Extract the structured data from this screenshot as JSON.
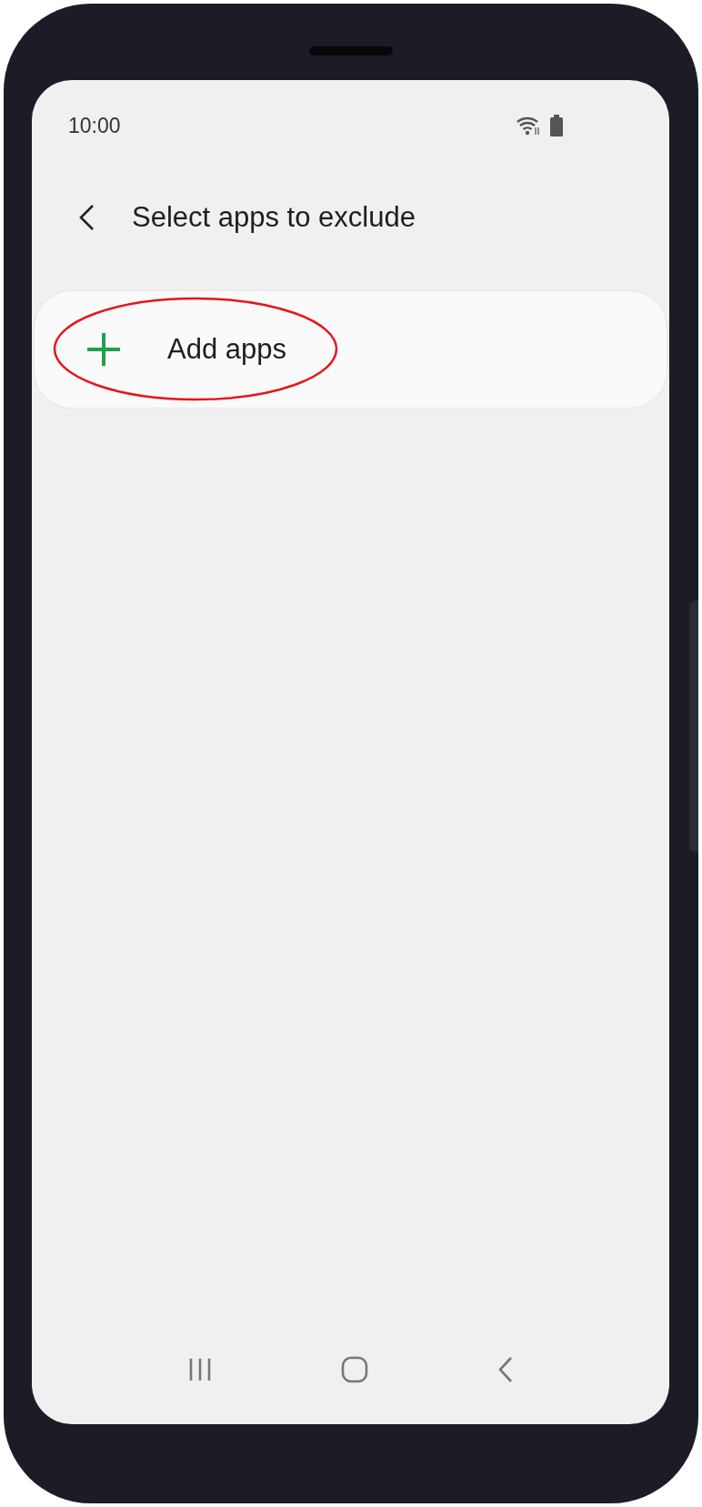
{
  "status_bar": {
    "time": "10:00"
  },
  "header": {
    "title": "Select apps to exclude"
  },
  "list": [
    {
      "kind": "add",
      "label": "Add apps",
      "highlighted": true
    }
  ]
}
